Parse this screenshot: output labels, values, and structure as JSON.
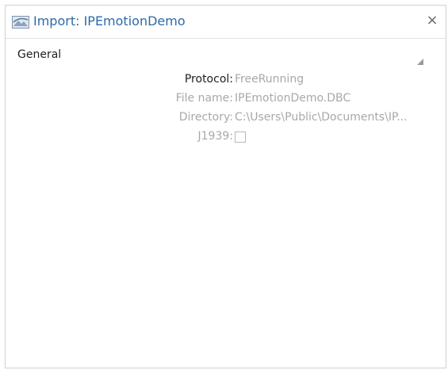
{
  "header": {
    "title": "Import: IPEmotionDemo",
    "close_label": "×",
    "icon": "import-dbc-icon"
  },
  "section": {
    "title": "General",
    "collapse_icon": "collapse-triangle-icon"
  },
  "properties": [
    {
      "label": "Protocol:",
      "value": "FreeRunning"
    },
    {
      "label": "File name:",
      "value": "IPEmotionDemo.DBC"
    },
    {
      "label": "Directory:",
      "value": "C:\\Users\\Public\\Documents\\IP..."
    },
    {
      "label": "J1939:",
      "checked": false
    }
  ],
  "colors": {
    "title": "#2e6aa8",
    "dim_text": "#a8a8a8",
    "active_text": "#1e1e1e"
  }
}
